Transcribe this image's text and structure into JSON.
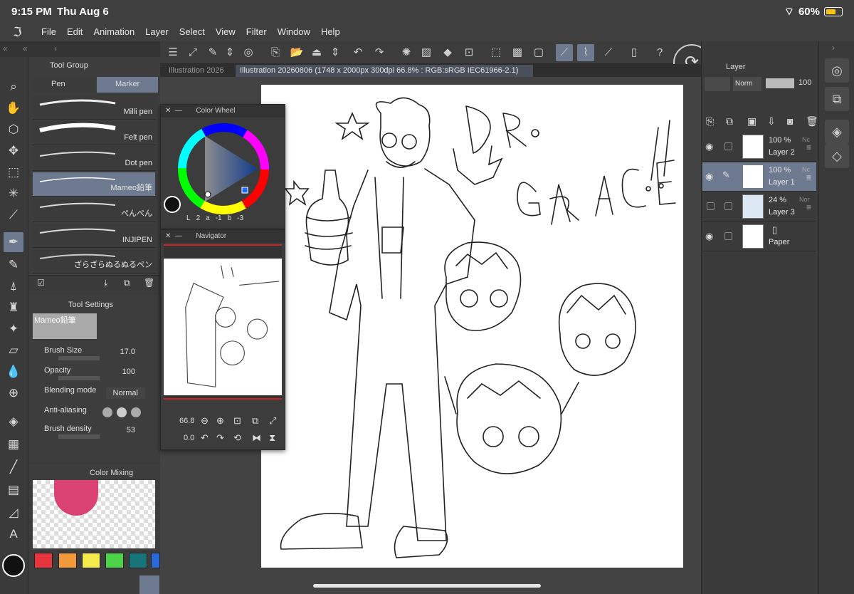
{
  "status": {
    "time": "9:15 PM",
    "date": "Thu Aug 6",
    "battery": "60%"
  },
  "menu": [
    "File",
    "Edit",
    "Animation",
    "Layer",
    "Select",
    "View",
    "Filter",
    "Window",
    "Help"
  ],
  "tool_group": {
    "title": "Tool Group",
    "tabs": [
      "Pen",
      "Marker"
    ],
    "brushes": [
      "Milli pen",
      "Felt pen",
      "Dot pen",
      "Mameo鉛筆",
      "ぺんぺん",
      "INJIPEN",
      "ざらざらぬるぬるペン"
    ]
  },
  "doc_tabs": [
    "Illustration 2026",
    "Illustration 20260806 (1748 x 2000px 300dpi 66.8% : RGB:sRGB IEC61966-2.1)"
  ],
  "color_wheel": {
    "title": "Color Wheel",
    "readout": [
      "L",
      "2",
      "a",
      "-1",
      "b",
      "-3"
    ]
  },
  "navigator": {
    "title": "Navigator",
    "zoom": "66.8",
    "rotation": "0.0"
  },
  "tool_settings": {
    "title": "Tool Settings",
    "brush_name": "Mameo鉛筆",
    "brush_size_label": "Brush Size",
    "brush_size": "17.0",
    "opacity_label": "Opacity",
    "opacity": "100",
    "blending_label": "Blending mode",
    "blending": "Normal",
    "antialias_label": "Anti-aliasing",
    "density_label": "Brush density",
    "density": "53"
  },
  "color_mixing": {
    "title": "Color Mixing"
  },
  "swatches": [
    "#e8343c",
    "#f29a3a",
    "#f4ea4a",
    "#4cd34a",
    "#17757a",
    "#2a6ad8"
  ],
  "layer_panel": {
    "title": "Layer",
    "blend": "Norm",
    "opacity": "100",
    "layers": [
      {
        "pct": "100 %",
        "mode": "Nc",
        "name": "Layer 2"
      },
      {
        "pct": "100 %",
        "mode": "Nc",
        "name": "Layer 1"
      },
      {
        "pct": "24 %",
        "mode": "Nor",
        "name": "Layer 3"
      },
      {
        "pct": "",
        "mode": "",
        "name": "Paper"
      }
    ]
  },
  "accent": "#6d7a8f"
}
